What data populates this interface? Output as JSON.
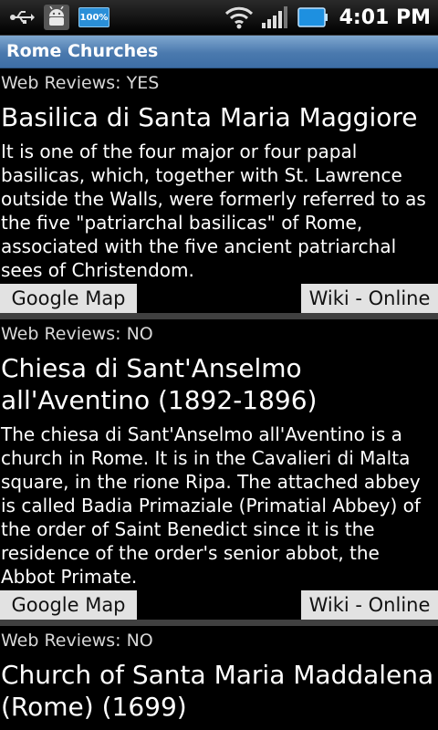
{
  "status": {
    "battery_label": "100%",
    "time": "4:01 PM"
  },
  "app": {
    "title": "Rome Churches"
  },
  "churches": [
    {
      "reviews": "Web Reviews: YES",
      "name": "Basilica di Santa Maria Maggiore",
      "description": "It is one of the four major or four papal basilicas, which, together with St. Lawrence outside the Walls, were formerly referred to as the five \"patriarchal basilicas\" of Rome, associated with the five ancient patriarchal sees of Christendom.",
      "map_button": "Google Map",
      "wiki_button": "Wiki - Online"
    },
    {
      "reviews": "Web Reviews: NO",
      "name": "Chiesa di Sant'Anselmo all'Aventino (1892-1896)",
      "description": "The chiesa di Sant'Anselmo all'Aventino is a church in Rome. It is in the Cavalieri di Malta square, in the rione Ripa. The attached abbey is called Badia Primaziale (Primatial Abbey) of the order of Saint Benedict since it is the residence of the order's senior abbot, the Abbot Primate.",
      "map_button": "Google Map",
      "wiki_button": "Wiki - Online"
    },
    {
      "reviews": "Web Reviews: NO",
      "name": "Church of Santa Maria Maddalena (Rome) (1699)"
    }
  ]
}
